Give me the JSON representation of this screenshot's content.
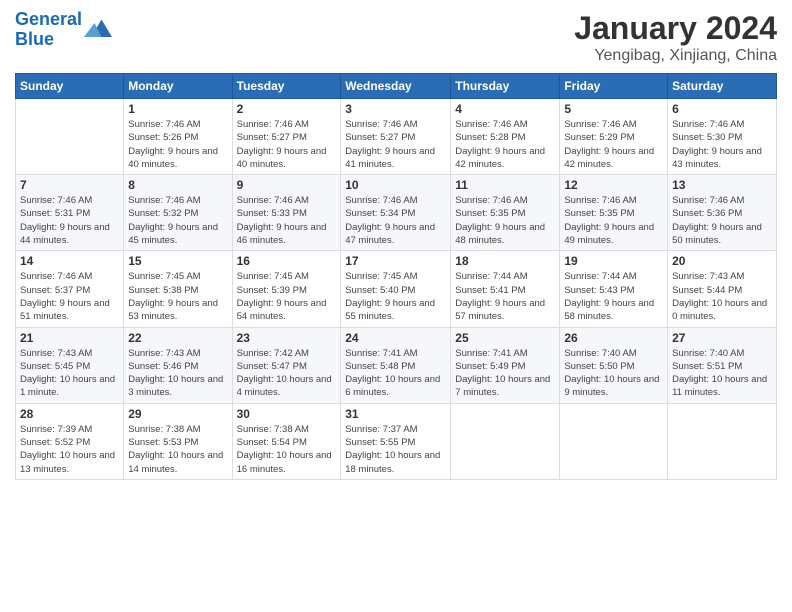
{
  "logo": {
    "line1": "General",
    "line2": "Blue"
  },
  "title": "January 2024",
  "location": "Yengibag, Xinjiang, China",
  "days_of_week": [
    "Sunday",
    "Monday",
    "Tuesday",
    "Wednesday",
    "Thursday",
    "Friday",
    "Saturday"
  ],
  "weeks": [
    [
      {
        "day": "",
        "sunrise": "",
        "sunset": "",
        "daylight": ""
      },
      {
        "day": "1",
        "sunrise": "Sunrise: 7:46 AM",
        "sunset": "Sunset: 5:26 PM",
        "daylight": "Daylight: 9 hours and 40 minutes."
      },
      {
        "day": "2",
        "sunrise": "Sunrise: 7:46 AM",
        "sunset": "Sunset: 5:27 PM",
        "daylight": "Daylight: 9 hours and 40 minutes."
      },
      {
        "day": "3",
        "sunrise": "Sunrise: 7:46 AM",
        "sunset": "Sunset: 5:27 PM",
        "daylight": "Daylight: 9 hours and 41 minutes."
      },
      {
        "day": "4",
        "sunrise": "Sunrise: 7:46 AM",
        "sunset": "Sunset: 5:28 PM",
        "daylight": "Daylight: 9 hours and 42 minutes."
      },
      {
        "day": "5",
        "sunrise": "Sunrise: 7:46 AM",
        "sunset": "Sunset: 5:29 PM",
        "daylight": "Daylight: 9 hours and 42 minutes."
      },
      {
        "day": "6",
        "sunrise": "Sunrise: 7:46 AM",
        "sunset": "Sunset: 5:30 PM",
        "daylight": "Daylight: 9 hours and 43 minutes."
      }
    ],
    [
      {
        "day": "7",
        "sunrise": "Sunrise: 7:46 AM",
        "sunset": "Sunset: 5:31 PM",
        "daylight": "Daylight: 9 hours and 44 minutes."
      },
      {
        "day": "8",
        "sunrise": "Sunrise: 7:46 AM",
        "sunset": "Sunset: 5:32 PM",
        "daylight": "Daylight: 9 hours and 45 minutes."
      },
      {
        "day": "9",
        "sunrise": "Sunrise: 7:46 AM",
        "sunset": "Sunset: 5:33 PM",
        "daylight": "Daylight: 9 hours and 46 minutes."
      },
      {
        "day": "10",
        "sunrise": "Sunrise: 7:46 AM",
        "sunset": "Sunset: 5:34 PM",
        "daylight": "Daylight: 9 hours and 47 minutes."
      },
      {
        "day": "11",
        "sunrise": "Sunrise: 7:46 AM",
        "sunset": "Sunset: 5:35 PM",
        "daylight": "Daylight: 9 hours and 48 minutes."
      },
      {
        "day": "12",
        "sunrise": "Sunrise: 7:46 AM",
        "sunset": "Sunset: 5:35 PM",
        "daylight": "Daylight: 9 hours and 49 minutes."
      },
      {
        "day": "13",
        "sunrise": "Sunrise: 7:46 AM",
        "sunset": "Sunset: 5:36 PM",
        "daylight": "Daylight: 9 hours and 50 minutes."
      }
    ],
    [
      {
        "day": "14",
        "sunrise": "Sunrise: 7:46 AM",
        "sunset": "Sunset: 5:37 PM",
        "daylight": "Daylight: 9 hours and 51 minutes."
      },
      {
        "day": "15",
        "sunrise": "Sunrise: 7:45 AM",
        "sunset": "Sunset: 5:38 PM",
        "daylight": "Daylight: 9 hours and 53 minutes."
      },
      {
        "day": "16",
        "sunrise": "Sunrise: 7:45 AM",
        "sunset": "Sunset: 5:39 PM",
        "daylight": "Daylight: 9 hours and 54 minutes."
      },
      {
        "day": "17",
        "sunrise": "Sunrise: 7:45 AM",
        "sunset": "Sunset: 5:40 PM",
        "daylight": "Daylight: 9 hours and 55 minutes."
      },
      {
        "day": "18",
        "sunrise": "Sunrise: 7:44 AM",
        "sunset": "Sunset: 5:41 PM",
        "daylight": "Daylight: 9 hours and 57 minutes."
      },
      {
        "day": "19",
        "sunrise": "Sunrise: 7:44 AM",
        "sunset": "Sunset: 5:43 PM",
        "daylight": "Daylight: 9 hours and 58 minutes."
      },
      {
        "day": "20",
        "sunrise": "Sunrise: 7:43 AM",
        "sunset": "Sunset: 5:44 PM",
        "daylight": "Daylight: 10 hours and 0 minutes."
      }
    ],
    [
      {
        "day": "21",
        "sunrise": "Sunrise: 7:43 AM",
        "sunset": "Sunset: 5:45 PM",
        "daylight": "Daylight: 10 hours and 1 minute."
      },
      {
        "day": "22",
        "sunrise": "Sunrise: 7:43 AM",
        "sunset": "Sunset: 5:46 PM",
        "daylight": "Daylight: 10 hours and 3 minutes."
      },
      {
        "day": "23",
        "sunrise": "Sunrise: 7:42 AM",
        "sunset": "Sunset: 5:47 PM",
        "daylight": "Daylight: 10 hours and 4 minutes."
      },
      {
        "day": "24",
        "sunrise": "Sunrise: 7:41 AM",
        "sunset": "Sunset: 5:48 PM",
        "daylight": "Daylight: 10 hours and 6 minutes."
      },
      {
        "day": "25",
        "sunrise": "Sunrise: 7:41 AM",
        "sunset": "Sunset: 5:49 PM",
        "daylight": "Daylight: 10 hours and 7 minutes."
      },
      {
        "day": "26",
        "sunrise": "Sunrise: 7:40 AM",
        "sunset": "Sunset: 5:50 PM",
        "daylight": "Daylight: 10 hours and 9 minutes."
      },
      {
        "day": "27",
        "sunrise": "Sunrise: 7:40 AM",
        "sunset": "Sunset: 5:51 PM",
        "daylight": "Daylight: 10 hours and 11 minutes."
      }
    ],
    [
      {
        "day": "28",
        "sunrise": "Sunrise: 7:39 AM",
        "sunset": "Sunset: 5:52 PM",
        "daylight": "Daylight: 10 hours and 13 minutes."
      },
      {
        "day": "29",
        "sunrise": "Sunrise: 7:38 AM",
        "sunset": "Sunset: 5:53 PM",
        "daylight": "Daylight: 10 hours and 14 minutes."
      },
      {
        "day": "30",
        "sunrise": "Sunrise: 7:38 AM",
        "sunset": "Sunset: 5:54 PM",
        "daylight": "Daylight: 10 hours and 16 minutes."
      },
      {
        "day": "31",
        "sunrise": "Sunrise: 7:37 AM",
        "sunset": "Sunset: 5:55 PM",
        "daylight": "Daylight: 10 hours and 18 minutes."
      },
      {
        "day": "",
        "sunrise": "",
        "sunset": "",
        "daylight": ""
      },
      {
        "day": "",
        "sunrise": "",
        "sunset": "",
        "daylight": ""
      },
      {
        "day": "",
        "sunrise": "",
        "sunset": "",
        "daylight": ""
      }
    ]
  ]
}
